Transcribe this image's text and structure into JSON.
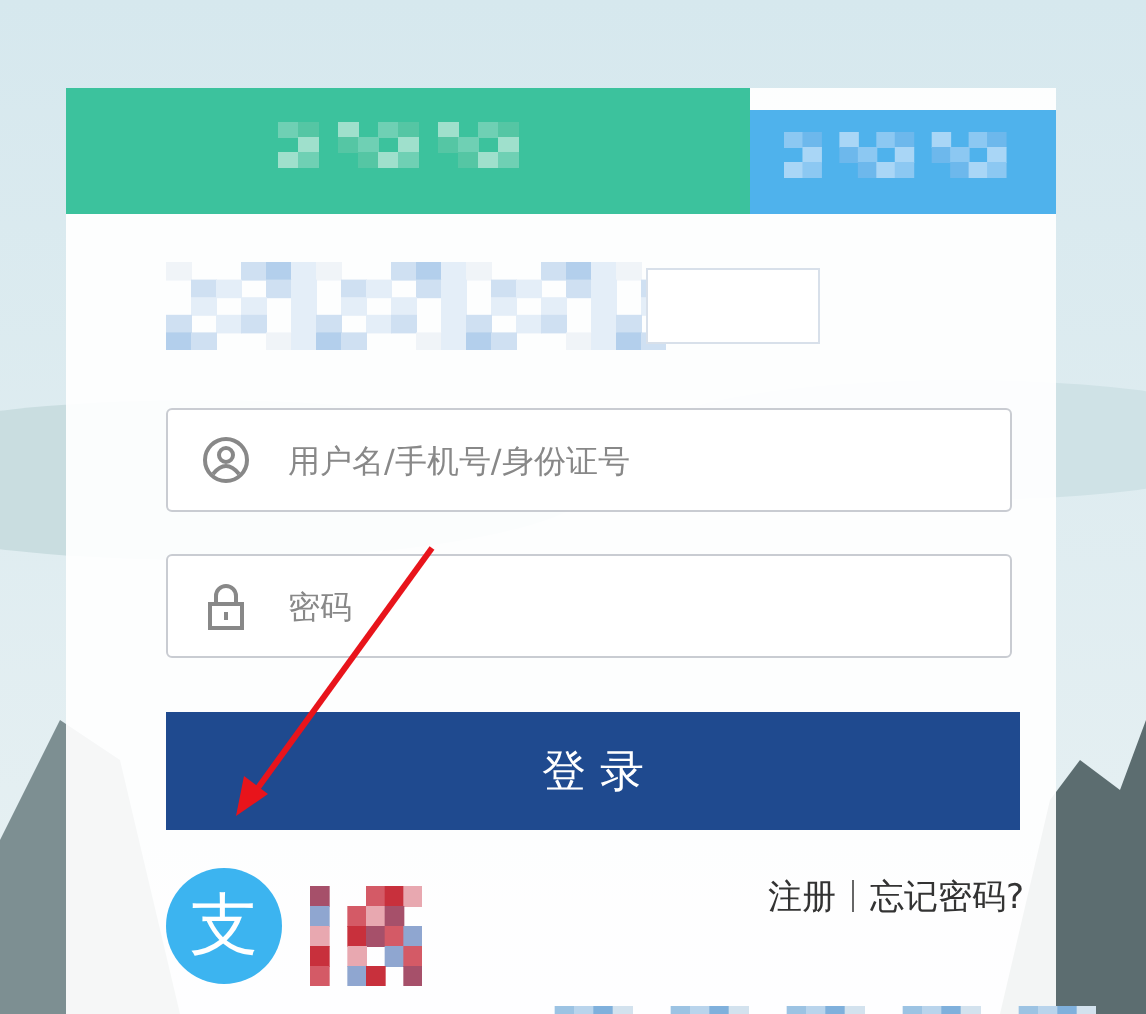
{
  "tabs": [
    {
      "selected": true
    },
    {
      "selected": false
    }
  ],
  "fields": [
    {
      "kind": "user",
      "placeholder": "用户名/手机号/身份证号"
    },
    {
      "kind": "lock",
      "placeholder": "密码"
    }
  ],
  "login_button": "登 录",
  "alt_login": {
    "label": "支"
  },
  "links": [
    "注册",
    "忘记密码?"
  ]
}
